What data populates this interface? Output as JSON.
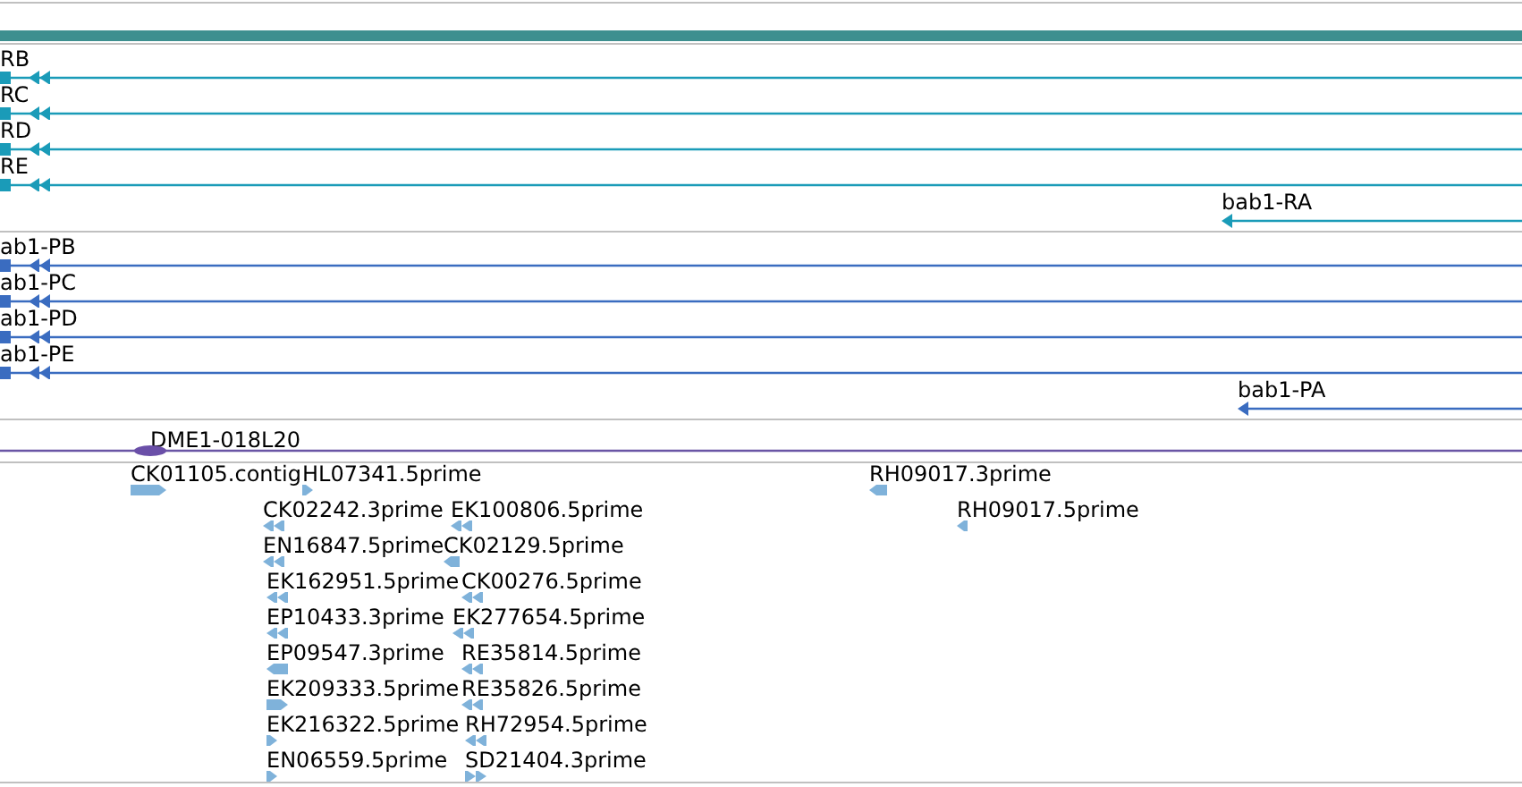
{
  "transcripts": [
    {
      "label": "RB",
      "kind": "minus"
    },
    {
      "label": "RC",
      "kind": "minus"
    },
    {
      "label": "RD",
      "kind": "minus"
    },
    {
      "label": "RE",
      "kind": "minus"
    },
    {
      "label": "bab1-RA",
      "kind": "minus"
    }
  ],
  "proteins": [
    {
      "label": "ab1-PB",
      "kind": "minus"
    },
    {
      "label": "ab1-PC",
      "kind": "minus"
    },
    {
      "label": "ab1-PD",
      "kind": "minus"
    },
    {
      "label": "ab1-PE",
      "kind": "minus"
    },
    {
      "label": "bab1-PA",
      "kind": "minus"
    }
  ],
  "clone": {
    "label": "DME1-018L20"
  },
  "ests": [
    {
      "label": "CK01105.contig",
      "kind": "plus"
    },
    {
      "label": "HL07341.5prime",
      "kind": "plus"
    },
    {
      "label": "CK02242.3prime",
      "kind": "minus"
    },
    {
      "label": "EK100806.5prime",
      "kind": "minus"
    },
    {
      "label": "EN16847.5prime",
      "kind": "minus"
    },
    {
      "label": "CK02129.5prime",
      "kind": "minus"
    },
    {
      "label": "EK162951.5prime",
      "kind": "minus"
    },
    {
      "label": "CK00276.5prime",
      "kind": "minus"
    },
    {
      "label": "EP10433.3prime",
      "kind": "minus"
    },
    {
      "label": "EK277654.5prime",
      "kind": "minus"
    },
    {
      "label": "EP09547.3prime",
      "kind": "minus"
    },
    {
      "label": "RE35814.5prime",
      "kind": "minus"
    },
    {
      "label": "EK209333.5prime",
      "kind": "plus"
    },
    {
      "label": "RE35826.5prime",
      "kind": "minus"
    },
    {
      "label": "EK216322.5prime",
      "kind": "plus"
    },
    {
      "label": "RH72954.5prime",
      "kind": "minus"
    },
    {
      "label": "EN06559.5prime",
      "kind": "plus"
    },
    {
      "label": "SD21404.3prime",
      "kind": "plus"
    },
    {
      "label": "RH09017.3prime",
      "kind": "minus"
    },
    {
      "label": "RH09017.5prime",
      "kind": "minus"
    }
  ]
}
